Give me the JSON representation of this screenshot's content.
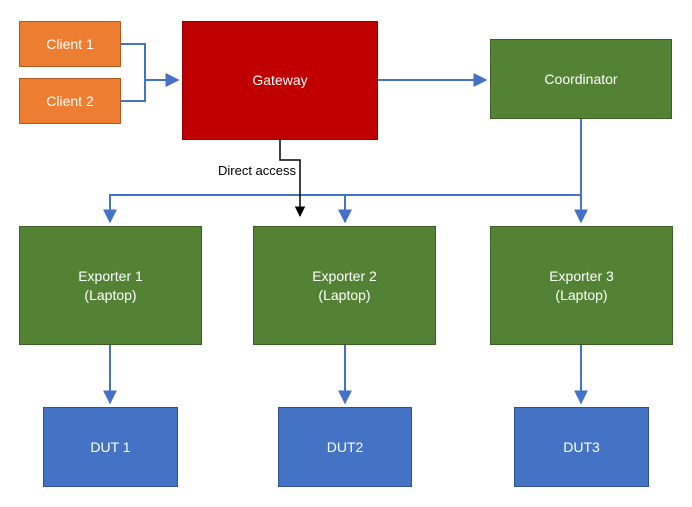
{
  "nodes": {
    "client1": "Client 1",
    "client2": "Client 2",
    "gateway": "Gateway",
    "coordinator": "Coordinator",
    "exporter1_l1": "Exporter 1",
    "exporter1_l2": "(Laptop)",
    "exporter2_l1": "Exporter 2",
    "exporter2_l2": "(Laptop)",
    "exporter3_l1": "Exporter 3",
    "exporter3_l2": "(Laptop)",
    "dut1": "DUT 1",
    "dut2": "DUT2",
    "dut3": "DUT3"
  },
  "labels": {
    "direct_access": "Direct access"
  },
  "edges": [
    {
      "from": "client1",
      "to": "gateway",
      "color": "blue"
    },
    {
      "from": "client2",
      "to": "gateway",
      "color": "blue"
    },
    {
      "from": "gateway",
      "to": "coordinator",
      "color": "blue"
    },
    {
      "from": "coordinator",
      "to": "exporter1",
      "color": "blue"
    },
    {
      "from": "coordinator",
      "to": "exporter2",
      "color": "blue"
    },
    {
      "from": "coordinator",
      "to": "exporter3",
      "color": "blue"
    },
    {
      "from": "exporter1",
      "to": "dut1",
      "color": "blue"
    },
    {
      "from": "exporter2",
      "to": "dut2",
      "color": "blue"
    },
    {
      "from": "exporter3",
      "to": "dut3",
      "color": "blue"
    },
    {
      "from": "gateway",
      "to": "exporter2",
      "color": "black",
      "label": "direct_access"
    }
  ],
  "palette": {
    "orange": "#ED7D31",
    "red": "#C00000",
    "green": "#548235",
    "blue_box": "#4472C4",
    "arrow_blue": "#4472C4",
    "arrow_black": "#000000"
  }
}
